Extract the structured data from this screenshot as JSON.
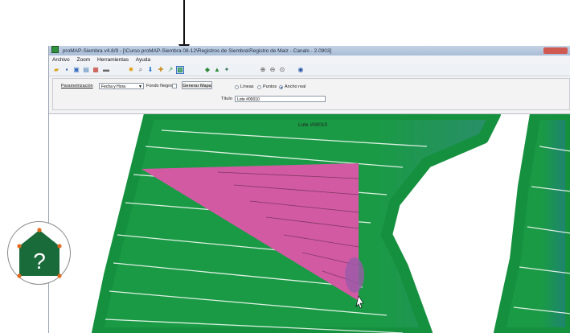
{
  "window": {
    "title": "proMAP-Siembra v4.8/9 - [\\Curso proMAP-Siembra 08-12\\Registros de Siembra\\Registro de Maiz - Canals - 2.0903]"
  },
  "menu": {
    "items": [
      "Archivo",
      "Zoom",
      "Herramientas",
      "Ayuda"
    ]
  },
  "panel": {
    "parametrizacion_label": "Parametrización",
    "parametrizacion_value": "Fecha y Hora",
    "fondo_negro_label": "Fondo Negro",
    "generar_button": "Generar Mapa",
    "radio_lineas": "Líneas",
    "radio_puntos": "Puntos",
    "radio_ancho": "Ancho real",
    "titulo_label": "Título",
    "titulo_value": "Lote #00010"
  },
  "map": {
    "label": "Lote #00010"
  },
  "help": {
    "symbol": "?"
  },
  "colors": {
    "field_green": "#1a9a45",
    "field_teal": "#1f7f7a",
    "highlight_pink": "#d25aa3",
    "badge_green": "#1a6b3a",
    "badge_orange": "#e06a1f"
  }
}
